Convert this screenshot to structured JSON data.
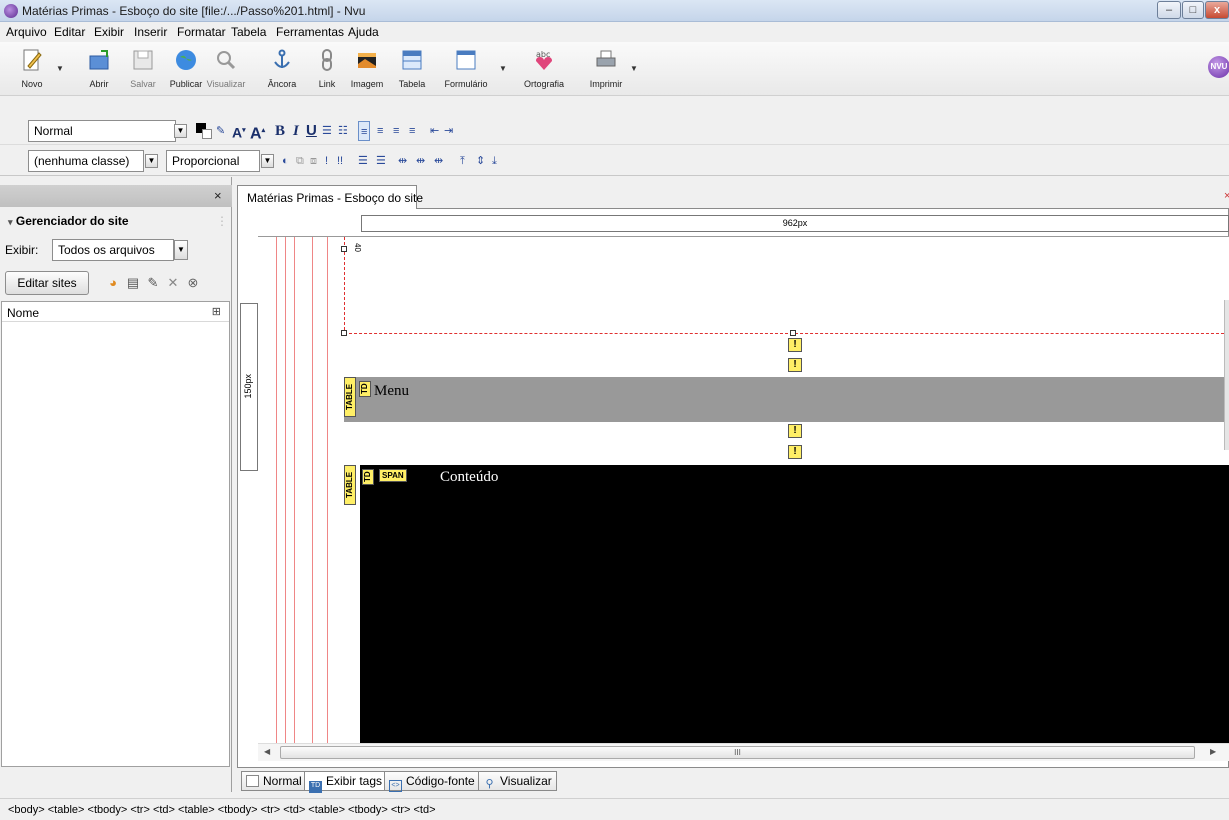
{
  "window": {
    "title": "Matérias Primas - Esboço do site [file:/.../Passo%201.html] - Nvu",
    "controls": [
      "minimize",
      "maximize",
      "close"
    ]
  },
  "menubar": [
    "Arquivo",
    "Editar",
    "Exibir",
    "Inserir",
    "Formatar",
    "Tabela",
    "Ferramentas",
    "Ajuda"
  ],
  "toolbar": {
    "buttons": [
      {
        "label": "Novo",
        "icon": "new-page-icon"
      },
      {
        "label": "Abrir",
        "icon": "open-icon"
      },
      {
        "label": "Salvar",
        "icon": "save-icon"
      },
      {
        "label": "Publicar",
        "icon": "publish-globe-icon"
      },
      {
        "label": "Visualizar",
        "icon": "preview-magnifier-icon"
      },
      {
        "label": "Âncora",
        "icon": "anchor-icon"
      },
      {
        "label": "Link",
        "icon": "link-chain-icon"
      },
      {
        "label": "Imagem",
        "icon": "image-icon"
      },
      {
        "label": "Tabela",
        "icon": "table-icon"
      },
      {
        "label": "Formulário",
        "icon": "form-icon"
      },
      {
        "label": "Ortografia",
        "icon": "spellcheck-icon"
      },
      {
        "label": "Imprimir",
        "icon": "print-icon"
      }
    ],
    "brand_badge": "NVU"
  },
  "format_bar": {
    "paragraph_style": "Normal",
    "class_select": "(nenhuma classe)",
    "font_select": "Proporcional"
  },
  "sidebar": {
    "close_glyph": "×",
    "title": "Gerenciador do site",
    "filter_label": "Exibir:",
    "filter_value": "Todos os arquivos",
    "edit_sites_button": "Editar sites",
    "tree_header": "Nome"
  },
  "document": {
    "tab_title": "Matérias Primas - Esboço do site",
    "ruler_top_label": "962px",
    "ruler_left_label": "150px",
    "menu_cell_text": "Menu",
    "content_cell_text": "Conteúdo",
    "tag_table": "TABLE",
    "tag_td": "TD",
    "tag_span": "SPAN",
    "warn_glyph": "!",
    "scroll_grip": "III"
  },
  "mode_tabs": [
    "Normal",
    "Exibir tags",
    "Código-fonte",
    "Visualizar"
  ],
  "statusbar": {
    "path": "<body> <table> <tbody> <tr> <td> <table> <tbody> <tr> <td> <table> <tbody> <tr> <td>"
  },
  "colors": {
    "menu_row": "#999999",
    "content_row": "#000000",
    "tag_badge": "#ffef66",
    "guide_line": "#ef8686"
  }
}
